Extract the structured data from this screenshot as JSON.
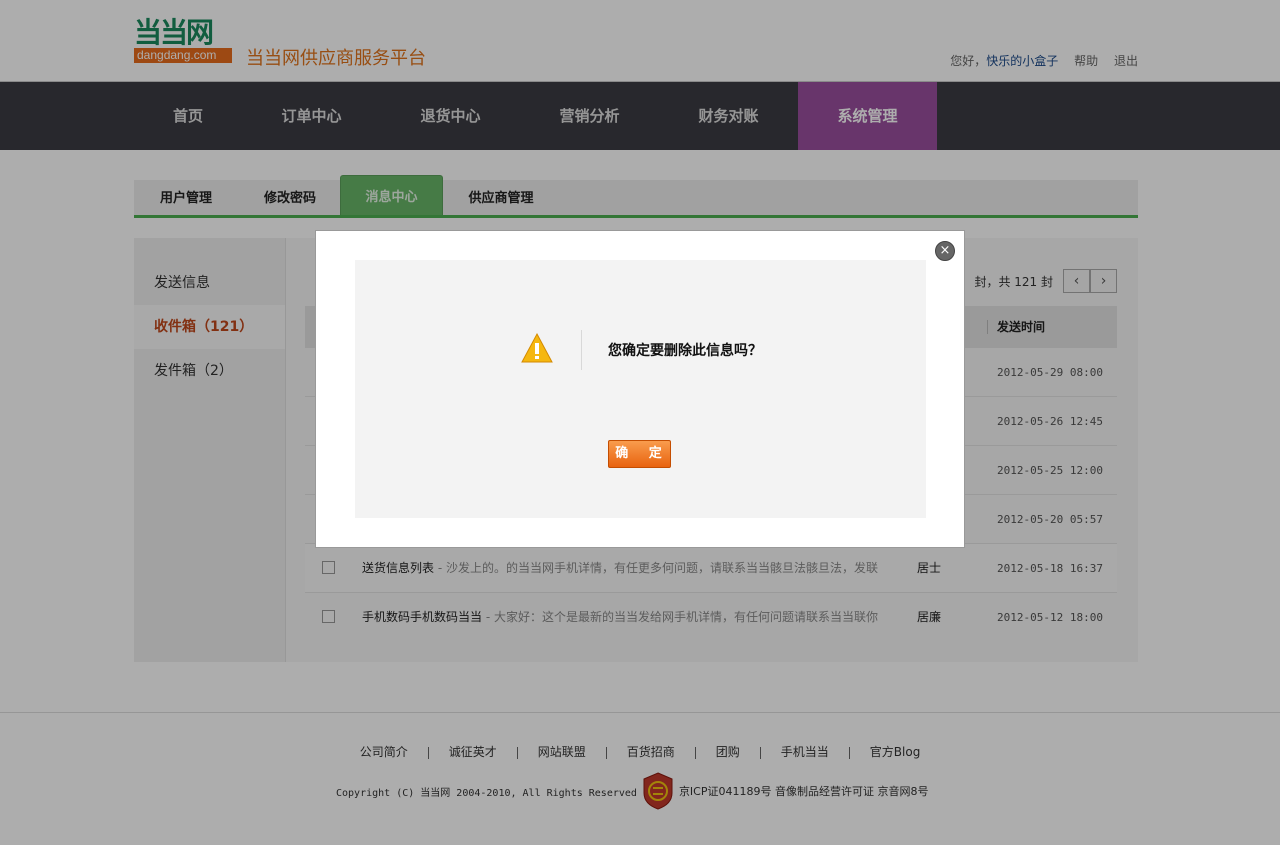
{
  "header": {
    "logo_cn": "当当网",
    "logo_en": "dangdang.com",
    "platform_title": "当当网供应商服务平台",
    "greeting": "您好，",
    "username": "快乐的小盒子",
    "help": "帮助",
    "logout": "退出"
  },
  "mainnav": {
    "items": [
      {
        "label": "首页"
      },
      {
        "label": "订单中心"
      },
      {
        "label": "退货中心"
      },
      {
        "label": "营销分析"
      },
      {
        "label": "财务对账"
      },
      {
        "label": "系统管理"
      }
    ],
    "active": "系统管理",
    "active_color": "#9a4f9e"
  },
  "subtabs": {
    "items": [
      {
        "label": "用户管理"
      },
      {
        "label": "修改密码"
      },
      {
        "label": "消息中心"
      },
      {
        "label": "供应商管理"
      }
    ],
    "active": "消息中心",
    "accent_color": "#4caf50"
  },
  "leftmenu": {
    "items": [
      {
        "label": "发送信息"
      },
      {
        "label": "收件箱（121）"
      },
      {
        "label": "发件箱（2）"
      }
    ],
    "active": "收件箱（121）"
  },
  "messages": {
    "pager_text": "封，共 121 封",
    "header_time": "发送时间",
    "rows": [
      {
        "title": "",
        "preview": "",
        "sender": "",
        "time": "2012-05-29 08:00"
      },
      {
        "title": "",
        "preview": "",
        "sender": "",
        "time": "2012-05-26 12:45"
      },
      {
        "title": "",
        "preview": "",
        "sender": "",
        "time": "2012-05-25 12:00"
      },
      {
        "title": "",
        "preview": "",
        "sender": "",
        "time": "2012-05-20 05:57"
      },
      {
        "title": "送货信息列表",
        "preview": " - 沙发上的。的当当网手机详情，有任更多何问题，请联系当当骸旦法骸旦法，发联",
        "sender": "居士",
        "time": "2012-05-18 16:37"
      },
      {
        "title": "手机数码手机数码当当",
        "preview": " - 大家好：这个是最新的当当发给网手机详情，有任何问题请联系当当联你",
        "sender": "居廉",
        "time": "2012-05-12 18:00"
      }
    ]
  },
  "footer": {
    "links": [
      "公司简介",
      "诚征英才",
      "网站联盟",
      "百货招商",
      "团购",
      "手机当当",
      "官方Blog"
    ],
    "copyright": "Copyright (C) 当当网 2004-2010, All Rights Reserved",
    "icp": "京ICP证041189号  音像制品经营许可证 京音网8号"
  },
  "modal": {
    "message": "您确定要删除此信息吗？",
    "ok_label": "确 定",
    "close_icon": "close-icon",
    "warning_icon": "warning-icon"
  }
}
